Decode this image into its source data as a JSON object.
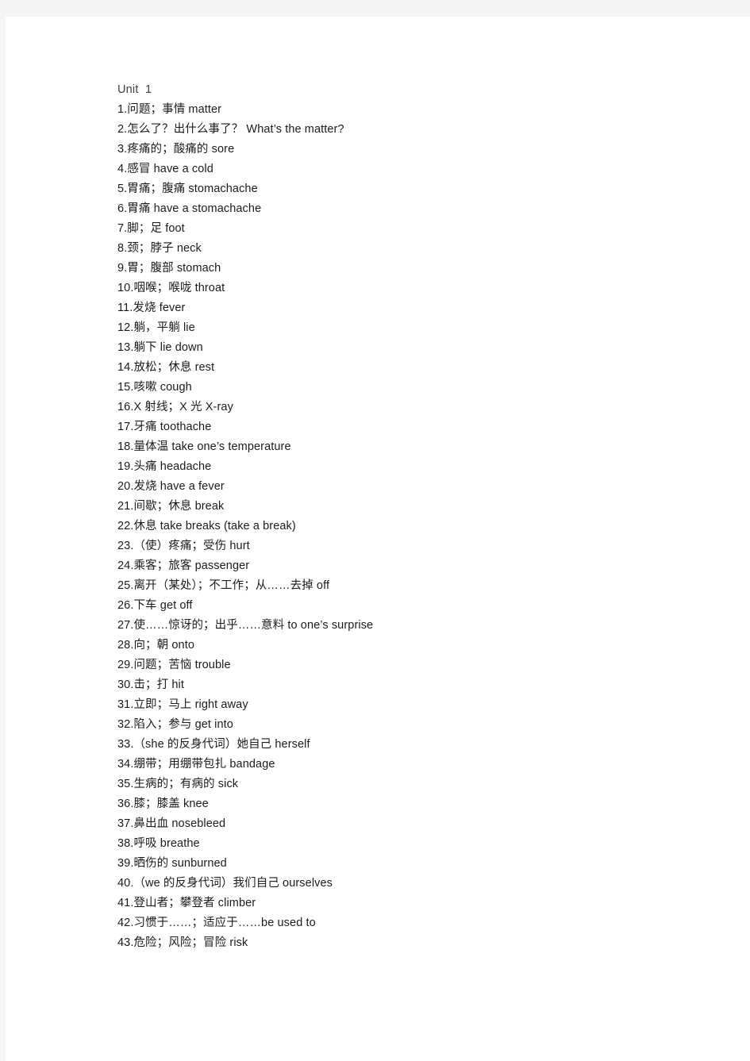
{
  "document": {
    "heading": "Unit  1",
    "entries": [
      "1.问题；事情 matter",
      "2.怎么了？出什么事了？ What’s the matter?",
      "3.疼痛的；酸痛的 sore",
      "4.感冒 have a cold",
      "5.胃痛；腹痛 stomachache",
      "6.胃痛 have a stomachache",
      "7.脚；足 foot",
      "8.颈；脖子 neck",
      "9.胃；腹部 stomach",
      "10.咽喉；喉咙 throat",
      "11.发烧 fever",
      "12.躺，平躺 lie",
      "13.躺下 lie down",
      "14.放松；休息 rest",
      "15.咳嗽 cough",
      "16.X 射线；X 光 X-ray",
      "17.牙痛 toothache",
      "18.量体温 take one’s temperature",
      "19.头痛 headache",
      "20.发烧 have a fever",
      "21.间歇；休息 break",
      "22.休息 take breaks (take a break)",
      "23.（使）疼痛；受伤 hurt",
      "24.乘客；旅客 passenger",
      "25.离开（某处）；不工作；从……去掉 off",
      "26.下车 get off",
      "27.使……惊讶的；出乎……意料 to one’s surprise",
      "28.向；朝 onto",
      "29.问题；苦恼 trouble",
      "30.击；打 hit",
      "31.立即；马上 right away",
      "32.陷入；参与 get into",
      "33.（she 的反身代词）她自己 herself",
      "34.绷带；用绷带包扎 bandage",
      "35.生病的；有病的 sick",
      "36.膝；膝盖 knee",
      "37.鼻出血 nosebleed",
      "38.呼吸 breathe",
      "39.晒伤的 sunburned",
      "40.（we 的反身代词）我们自己 ourselves",
      "41.登山者；攀登者 climber",
      "42.习惯于……；适应于……be used to",
      "43.危险；风险；冒险 risk"
    ]
  }
}
